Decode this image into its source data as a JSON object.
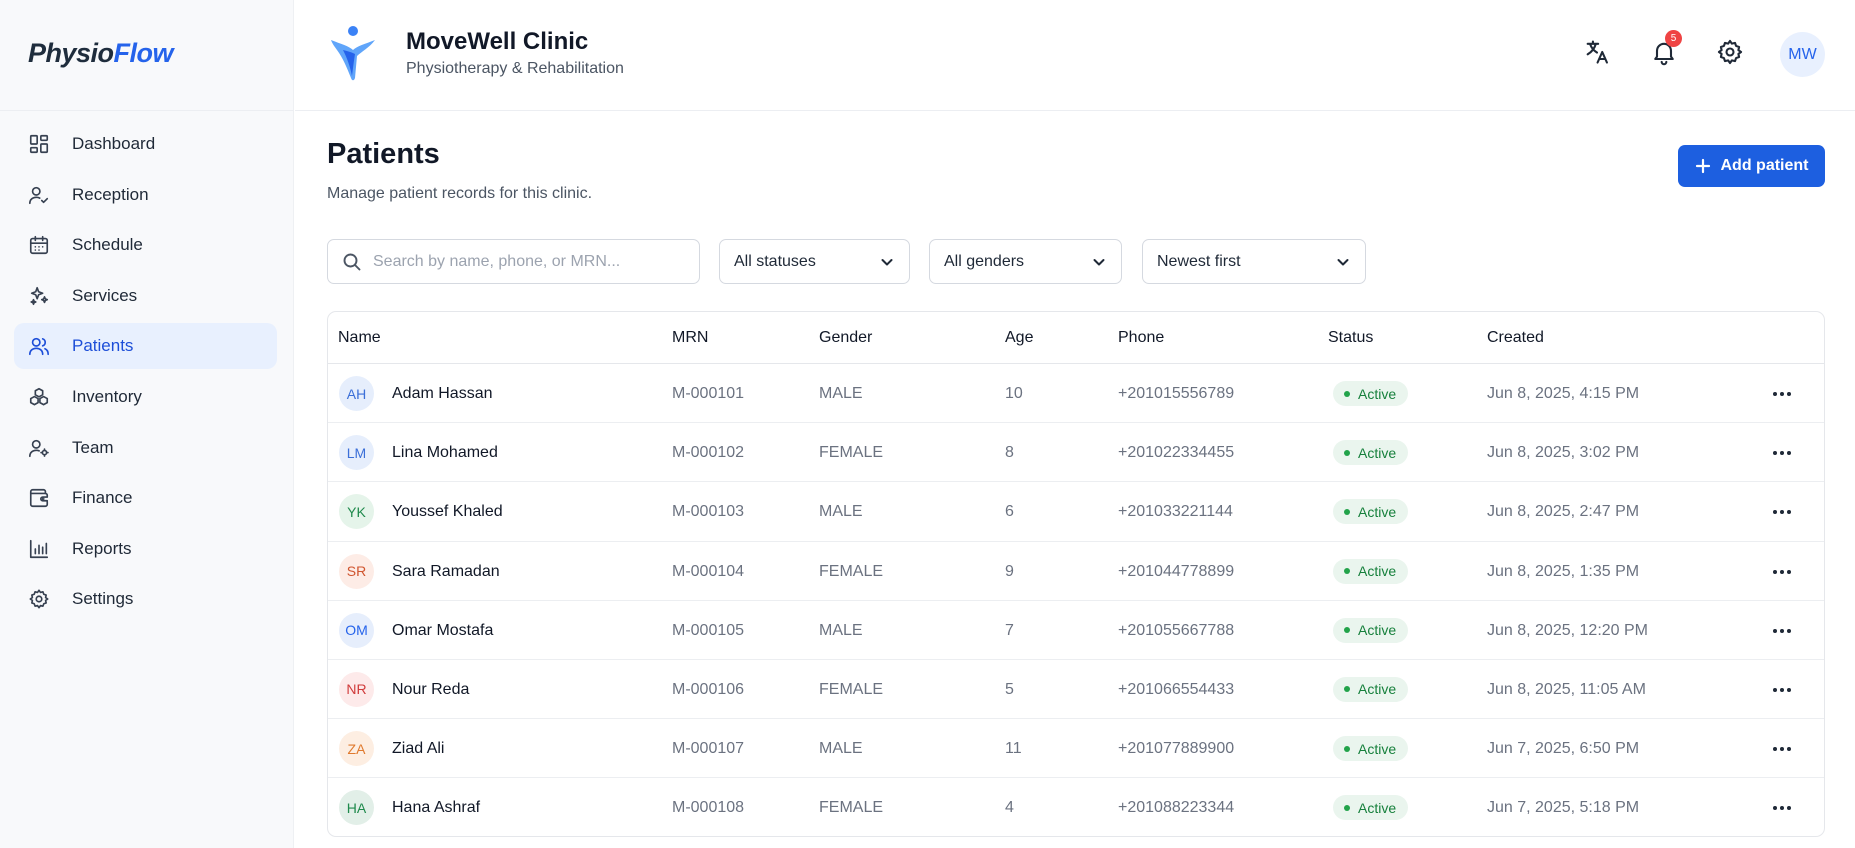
{
  "app": {
    "brand_part1": "Physio",
    "brand_part2": "Flow"
  },
  "sidebar": {
    "items": [
      {
        "label": "Dashboard",
        "icon": "dashboard-icon",
        "active": false
      },
      {
        "label": "Reception",
        "icon": "user-check-icon",
        "active": false
      },
      {
        "label": "Schedule",
        "icon": "calendar-icon",
        "active": false
      },
      {
        "label": "Services",
        "icon": "sparkles-icon",
        "active": false
      },
      {
        "label": "Patients",
        "icon": "users-icon",
        "active": true
      },
      {
        "label": "Inventory",
        "icon": "boxes-icon",
        "active": false
      },
      {
        "label": "Team",
        "icon": "user-cog-icon",
        "active": false
      },
      {
        "label": "Finance",
        "icon": "wallet-icon",
        "active": false
      },
      {
        "label": "Reports",
        "icon": "bar-chart-icon",
        "active": false
      },
      {
        "label": "Settings",
        "icon": "gear-icon",
        "active": false
      }
    ]
  },
  "header": {
    "clinic_name": "MoveWell Clinic",
    "clinic_subtitle": "Physiotherapy & Rehabilitation",
    "notification_count": "5",
    "user_initials": "MW"
  },
  "main": {
    "title": "Patients",
    "subtitle": "Manage patient records for this clinic.",
    "add_button_label": "Add patient",
    "search_placeholder": "Search by name, phone, or MRN...",
    "status_filter": "All statuses",
    "gender_filter": "All genders",
    "sort": "Newest first"
  },
  "table": {
    "columns": [
      "Name",
      "MRN",
      "Gender",
      "Age",
      "Phone",
      "Status",
      "Created"
    ],
    "rows": [
      {
        "initials": "AH",
        "name": "Adam Hassan",
        "mrn": "M-000101",
        "gender": "MALE",
        "age": "10",
        "phone": "+201015556789",
        "status": "Active",
        "created": "Jun 8, 2025, 4:15 PM",
        "avatar_bg": "#e6eefc",
        "avatar_fg": "#3b6fd8"
      },
      {
        "initials": "LM",
        "name": "Lina Mohamed",
        "mrn": "M-000102",
        "gender": "FEMALE",
        "age": "8",
        "phone": "+201022334455",
        "status": "Active",
        "created": "Jun 8, 2025, 3:02 PM",
        "avatar_bg": "#e6eefc",
        "avatar_fg": "#3b6fd8"
      },
      {
        "initials": "YK",
        "name": "Youssef Khaled",
        "mrn": "M-000103",
        "gender": "MALE",
        "age": "6",
        "phone": "+201033221144",
        "status": "Active",
        "created": "Jun 8, 2025, 2:47 PM",
        "avatar_bg": "#e5f4ea",
        "avatar_fg": "#1f8a4c"
      },
      {
        "initials": "SR",
        "name": "Sara Ramadan",
        "mrn": "M-000104",
        "gender": "FEMALE",
        "age": "9",
        "phone": "+201044778899",
        "status": "Active",
        "created": "Jun 8, 2025, 1:35 PM",
        "avatar_bg": "#fdece6",
        "avatar_fg": "#d0552f"
      },
      {
        "initials": "OM",
        "name": "Omar Mostafa",
        "mrn": "M-000105",
        "gender": "MALE",
        "age": "7",
        "phone": "+201055667788",
        "status": "Active",
        "created": "Jun 8, 2025, 12:20 PM",
        "avatar_bg": "#e6eefc",
        "avatar_fg": "#2563eb"
      },
      {
        "initials": "NR",
        "name": "Nour Reda",
        "mrn": "M-000106",
        "gender": "FEMALE",
        "age": "5",
        "phone": "+201066554433",
        "status": "Active",
        "created": "Jun 8, 2025, 11:05 AM",
        "avatar_bg": "#fdeaea",
        "avatar_fg": "#d03b3b"
      },
      {
        "initials": "ZA",
        "name": "Ziad Ali",
        "mrn": "M-000107",
        "gender": "MALE",
        "age": "11",
        "phone": "+201077889900",
        "status": "Active",
        "created": "Jun 7, 2025, 6:50 PM",
        "avatar_bg": "#fdeee2",
        "avatar_fg": "#e07a2e"
      },
      {
        "initials": "HA",
        "name": "Hana Ashraf",
        "mrn": "M-000108",
        "gender": "FEMALE",
        "age": "4",
        "phone": "+201088223344",
        "status": "Active",
        "created": "Jun 7, 2025, 5:18 PM",
        "avatar_bg": "#e2efe8",
        "avatar_fg": "#1f8a4c"
      }
    ]
  },
  "colors": {
    "primary": "#1d5fe0",
    "active_nav_bg": "#e8f0fe",
    "status_active_bg": "#eaf5ee",
    "status_active_fg": "#16803c",
    "badge": "#ef4444"
  }
}
